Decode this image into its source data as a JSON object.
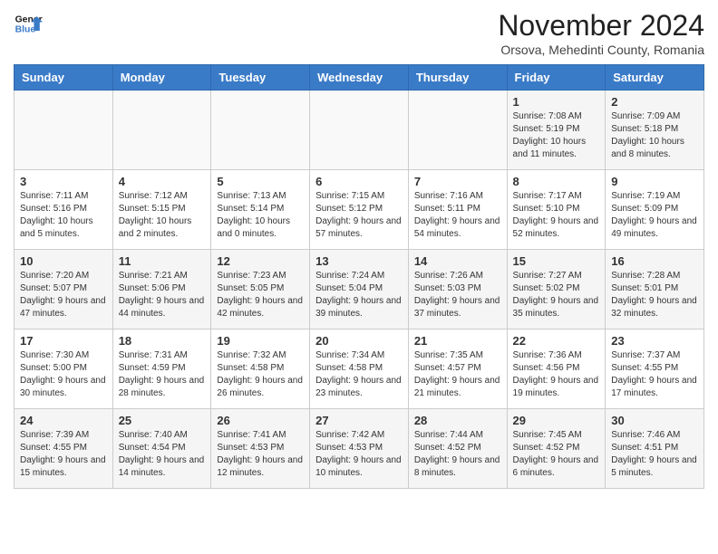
{
  "header": {
    "logo_line1": "General",
    "logo_line2": "Blue",
    "month_title": "November 2024",
    "subtitle": "Orsova, Mehedinti County, Romania"
  },
  "weekdays": [
    "Sunday",
    "Monday",
    "Tuesday",
    "Wednesday",
    "Thursday",
    "Friday",
    "Saturday"
  ],
  "rows": [
    [
      {
        "day": "",
        "info": ""
      },
      {
        "day": "",
        "info": ""
      },
      {
        "day": "",
        "info": ""
      },
      {
        "day": "",
        "info": ""
      },
      {
        "day": "",
        "info": ""
      },
      {
        "day": "1",
        "info": "Sunrise: 7:08 AM\nSunset: 5:19 PM\nDaylight: 10 hours and 11 minutes."
      },
      {
        "day": "2",
        "info": "Sunrise: 7:09 AM\nSunset: 5:18 PM\nDaylight: 10 hours and 8 minutes."
      }
    ],
    [
      {
        "day": "3",
        "info": "Sunrise: 7:11 AM\nSunset: 5:16 PM\nDaylight: 10 hours and 5 minutes."
      },
      {
        "day": "4",
        "info": "Sunrise: 7:12 AM\nSunset: 5:15 PM\nDaylight: 10 hours and 2 minutes."
      },
      {
        "day": "5",
        "info": "Sunrise: 7:13 AM\nSunset: 5:14 PM\nDaylight: 10 hours and 0 minutes."
      },
      {
        "day": "6",
        "info": "Sunrise: 7:15 AM\nSunset: 5:12 PM\nDaylight: 9 hours and 57 minutes."
      },
      {
        "day": "7",
        "info": "Sunrise: 7:16 AM\nSunset: 5:11 PM\nDaylight: 9 hours and 54 minutes."
      },
      {
        "day": "8",
        "info": "Sunrise: 7:17 AM\nSunset: 5:10 PM\nDaylight: 9 hours and 52 minutes."
      },
      {
        "day": "9",
        "info": "Sunrise: 7:19 AM\nSunset: 5:09 PM\nDaylight: 9 hours and 49 minutes."
      }
    ],
    [
      {
        "day": "10",
        "info": "Sunrise: 7:20 AM\nSunset: 5:07 PM\nDaylight: 9 hours and 47 minutes."
      },
      {
        "day": "11",
        "info": "Sunrise: 7:21 AM\nSunset: 5:06 PM\nDaylight: 9 hours and 44 minutes."
      },
      {
        "day": "12",
        "info": "Sunrise: 7:23 AM\nSunset: 5:05 PM\nDaylight: 9 hours and 42 minutes."
      },
      {
        "day": "13",
        "info": "Sunrise: 7:24 AM\nSunset: 5:04 PM\nDaylight: 9 hours and 39 minutes."
      },
      {
        "day": "14",
        "info": "Sunrise: 7:26 AM\nSunset: 5:03 PM\nDaylight: 9 hours and 37 minutes."
      },
      {
        "day": "15",
        "info": "Sunrise: 7:27 AM\nSunset: 5:02 PM\nDaylight: 9 hours and 35 minutes."
      },
      {
        "day": "16",
        "info": "Sunrise: 7:28 AM\nSunset: 5:01 PM\nDaylight: 9 hours and 32 minutes."
      }
    ],
    [
      {
        "day": "17",
        "info": "Sunrise: 7:30 AM\nSunset: 5:00 PM\nDaylight: 9 hours and 30 minutes."
      },
      {
        "day": "18",
        "info": "Sunrise: 7:31 AM\nSunset: 4:59 PM\nDaylight: 9 hours and 28 minutes."
      },
      {
        "day": "19",
        "info": "Sunrise: 7:32 AM\nSunset: 4:58 PM\nDaylight: 9 hours and 26 minutes."
      },
      {
        "day": "20",
        "info": "Sunrise: 7:34 AM\nSunset: 4:58 PM\nDaylight: 9 hours and 23 minutes."
      },
      {
        "day": "21",
        "info": "Sunrise: 7:35 AM\nSunset: 4:57 PM\nDaylight: 9 hours and 21 minutes."
      },
      {
        "day": "22",
        "info": "Sunrise: 7:36 AM\nSunset: 4:56 PM\nDaylight: 9 hours and 19 minutes."
      },
      {
        "day": "23",
        "info": "Sunrise: 7:37 AM\nSunset: 4:55 PM\nDaylight: 9 hours and 17 minutes."
      }
    ],
    [
      {
        "day": "24",
        "info": "Sunrise: 7:39 AM\nSunset: 4:55 PM\nDaylight: 9 hours and 15 minutes."
      },
      {
        "day": "25",
        "info": "Sunrise: 7:40 AM\nSunset: 4:54 PM\nDaylight: 9 hours and 14 minutes."
      },
      {
        "day": "26",
        "info": "Sunrise: 7:41 AM\nSunset: 4:53 PM\nDaylight: 9 hours and 12 minutes."
      },
      {
        "day": "27",
        "info": "Sunrise: 7:42 AM\nSunset: 4:53 PM\nDaylight: 9 hours and 10 minutes."
      },
      {
        "day": "28",
        "info": "Sunrise: 7:44 AM\nSunset: 4:52 PM\nDaylight: 9 hours and 8 minutes."
      },
      {
        "day": "29",
        "info": "Sunrise: 7:45 AM\nSunset: 4:52 PM\nDaylight: 9 hours and 6 minutes."
      },
      {
        "day": "30",
        "info": "Sunrise: 7:46 AM\nSunset: 4:51 PM\nDaylight: 9 hours and 5 minutes."
      }
    ]
  ]
}
